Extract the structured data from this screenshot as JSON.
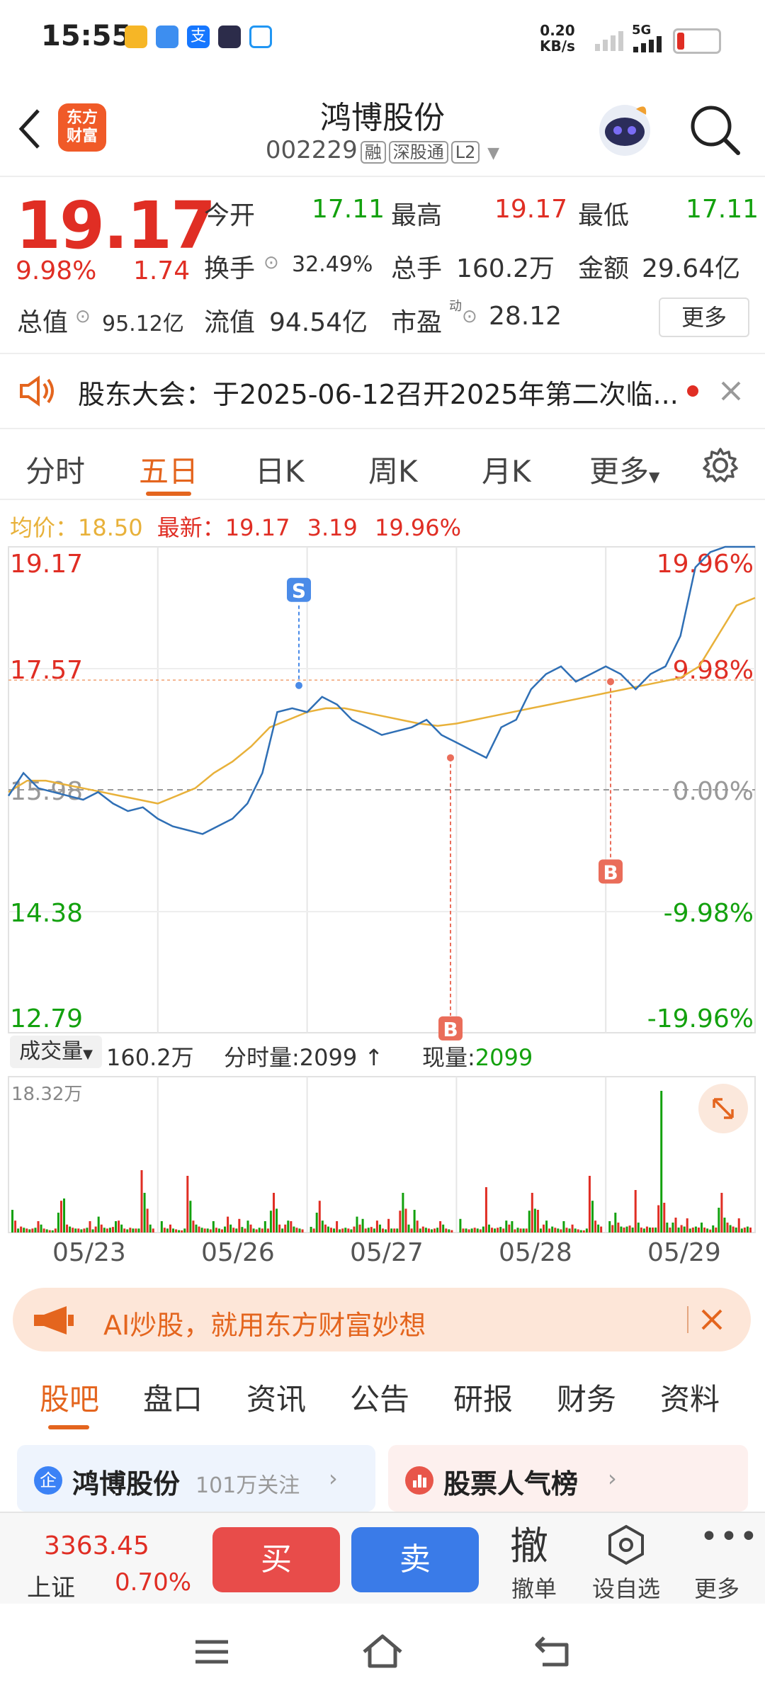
{
  "status_bar": {
    "time": "15:55",
    "net_speed": "0.20",
    "net_unit": "KB/s",
    "network": "5G"
  },
  "header": {
    "logo_line1": "东方",
    "logo_line2": "财富",
    "title": "鸿博股份",
    "code": "002229",
    "tags": [
      "融",
      "深股通",
      "L2"
    ]
  },
  "quote": {
    "price": "19.17",
    "change_pct": "9.98%",
    "change": "1.74",
    "open_label": "今开",
    "open": "17.11",
    "high_label": "最高",
    "high": "19.17",
    "low_label": "最低",
    "low": "17.11",
    "turnover_label": "换手",
    "turnover": "32.49%",
    "volume_label": "总手",
    "volume": "160.2万",
    "amount_label": "金额",
    "amount": "29.64亿",
    "mktcap_label": "总值",
    "mktcap": "95.12亿",
    "float_label": "流值",
    "float": "94.54亿",
    "pe_label": "市盈",
    "pe_sup": "动",
    "pe": "28.12",
    "more": "更多"
  },
  "notice": {
    "text": "股东大会：于2025-06-12召开2025年第二次临..."
  },
  "chart_tabs": [
    "分时",
    "五日",
    "日K",
    "周K",
    "月K",
    "更多"
  ],
  "chart_info": {
    "avg_label": "均价：",
    "avg": "18.50",
    "latest_label": "最新：",
    "latest": "19.17",
    "change": "3.19",
    "change_pct": "19.96%"
  },
  "chart_data": {
    "type": "line",
    "y_left_labels": [
      "19.17",
      "17.57",
      "15.98",
      "14.38",
      "12.79"
    ],
    "y_right_labels": [
      "19.96%",
      "9.98%",
      "0.00%",
      "-9.98%",
      "-19.96%"
    ],
    "ylim": [
      12.79,
      19.17
    ],
    "base_price": 15.98,
    "x_labels": [
      "05/23",
      "05/26",
      "05/27",
      "05/28",
      "05/29"
    ],
    "series": [
      {
        "name": "",
        "values": [
          15.9,
          16.2,
          16.0,
          15.95,
          15.9,
          15.85,
          15.95,
          15.8,
          15.7,
          15.75,
          15.6,
          15.5,
          15.45,
          15.4,
          15.5,
          15.6,
          15.8,
          16.2,
          17.0,
          17.05,
          17.0,
          17.2,
          17.1,
          16.9,
          16.8,
          16.7,
          16.75,
          16.8,
          16.9,
          16.7,
          16.6,
          16.5,
          16.4,
          16.8,
          16.9,
          17.3,
          17.5,
          17.6,
          17.4,
          17.5,
          17.6,
          17.5,
          17.3,
          17.5,
          17.6,
          18.0,
          18.9,
          19.1,
          19.17,
          19.17,
          19.17
        ]
      },
      {
        "name": "",
        "values": [
          15.95,
          16.1,
          16.1,
          16.05,
          16.0,
          15.95,
          15.9,
          15.85,
          15.8,
          15.9,
          16.0,
          16.2,
          16.35,
          16.55,
          16.8,
          16.9,
          17.0,
          17.05,
          17.05,
          17.0,
          16.95,
          16.9,
          16.85,
          16.82,
          16.85,
          16.9,
          16.95,
          17.0,
          17.05,
          17.1,
          17.15,
          17.2,
          17.25,
          17.3,
          17.35,
          17.4,
          17.45,
          17.6,
          18.0,
          18.4,
          18.5
        ]
      }
    ],
    "markers": [
      {
        "label": "S",
        "color": "#4a8be8"
      },
      {
        "label": "B",
        "color": "#ea6d5a"
      },
      {
        "label": "B",
        "color": "#ea6d5a"
      }
    ]
  },
  "volume_info": {
    "label": "成交量",
    "total": "160.2万",
    "tick_label": "分时量:",
    "tick": "2099",
    "now_label": "现量:",
    "now": "2099",
    "max": "18.32万"
  },
  "volume_data": {
    "values": [
      0.2,
      0.3,
      0.1,
      0.15,
      0.12,
      0.1,
      0.08,
      0.1,
      0.12,
      0.1,
      0.2,
      0.1,
      0.08,
      0.06,
      0.05,
      0.1,
      0.5,
      0.8,
      0.3,
      0.2,
      0.15,
      0.12,
      0.1,
      0.1,
      0.08,
      0.1,
      0.12,
      0.1,
      0.08,
      0.15,
      0.4,
      0.2,
      0.12,
      0.1,
      0.12,
      0.14,
      0.1,
      0.3,
      0.2,
      0.1,
      0.08,
      0.12,
      0.1,
      0.1,
      0.1,
      0.55,
      1.0,
      0.6,
      0.2,
      0.1
    ]
  },
  "ad_banner": {
    "text": "AI炒股，就用东方财富妙想"
  },
  "section_tabs": [
    "股吧",
    "盘口",
    "资讯",
    "公告",
    "研报",
    "财务",
    "资料"
  ],
  "cards": {
    "left_title": "鸿博股份",
    "left_sub": "101万关注",
    "right_title": "股票人气榜"
  },
  "bottom_bar": {
    "index_value": "3363.45",
    "index_name": "上证",
    "index_change": "0.70%",
    "buy": "买",
    "sell": "卖",
    "cancel_icon_text": "撤",
    "cancel": "撤单",
    "watch": "设自选",
    "more": "更多"
  },
  "colors": {
    "up": "#e02e24",
    "down": "#13a10e",
    "accent": "#e4651e",
    "price_line": "#2f6fb5",
    "avg_line": "#e8b13a"
  }
}
